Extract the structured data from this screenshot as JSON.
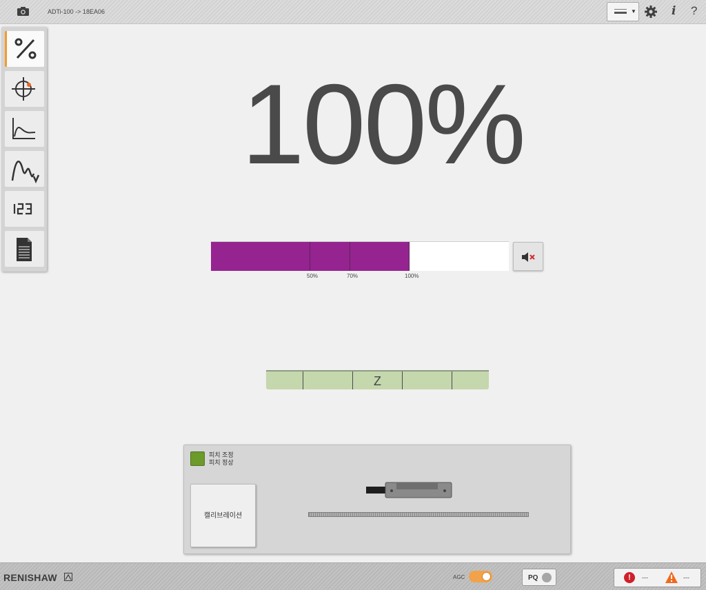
{
  "header": {
    "title": "ADTi-100 -> 18EA06",
    "info_label": "i",
    "help_label": "?"
  },
  "sidebar": {
    "items": [
      {
        "name": "percent",
        "label": "%"
      },
      {
        "name": "target"
      },
      {
        "name": "curve"
      },
      {
        "name": "waveform"
      },
      {
        "name": "numeric",
        "label": "123"
      },
      {
        "name": "document"
      }
    ]
  },
  "signal": {
    "value_text": "100%",
    "level": 1.0,
    "fill_color": "#952490",
    "ticks": [
      {
        "label": "50%"
      },
      {
        "label": "70%"
      },
      {
        "label": "100%"
      }
    ]
  },
  "zbar": {
    "label": "Z",
    "color": "#c5d7ad"
  },
  "panel": {
    "status_color": "#6c9a2b",
    "status_line1": "피치 조정",
    "status_line2": "피치 정상",
    "calibrate_label": "캘리브레이션"
  },
  "footer": {
    "logo": "RENISHAW",
    "agc_label": "AGC",
    "agc_on": true,
    "pq_label": "PQ",
    "error_count": "---",
    "warning_count": "---"
  }
}
